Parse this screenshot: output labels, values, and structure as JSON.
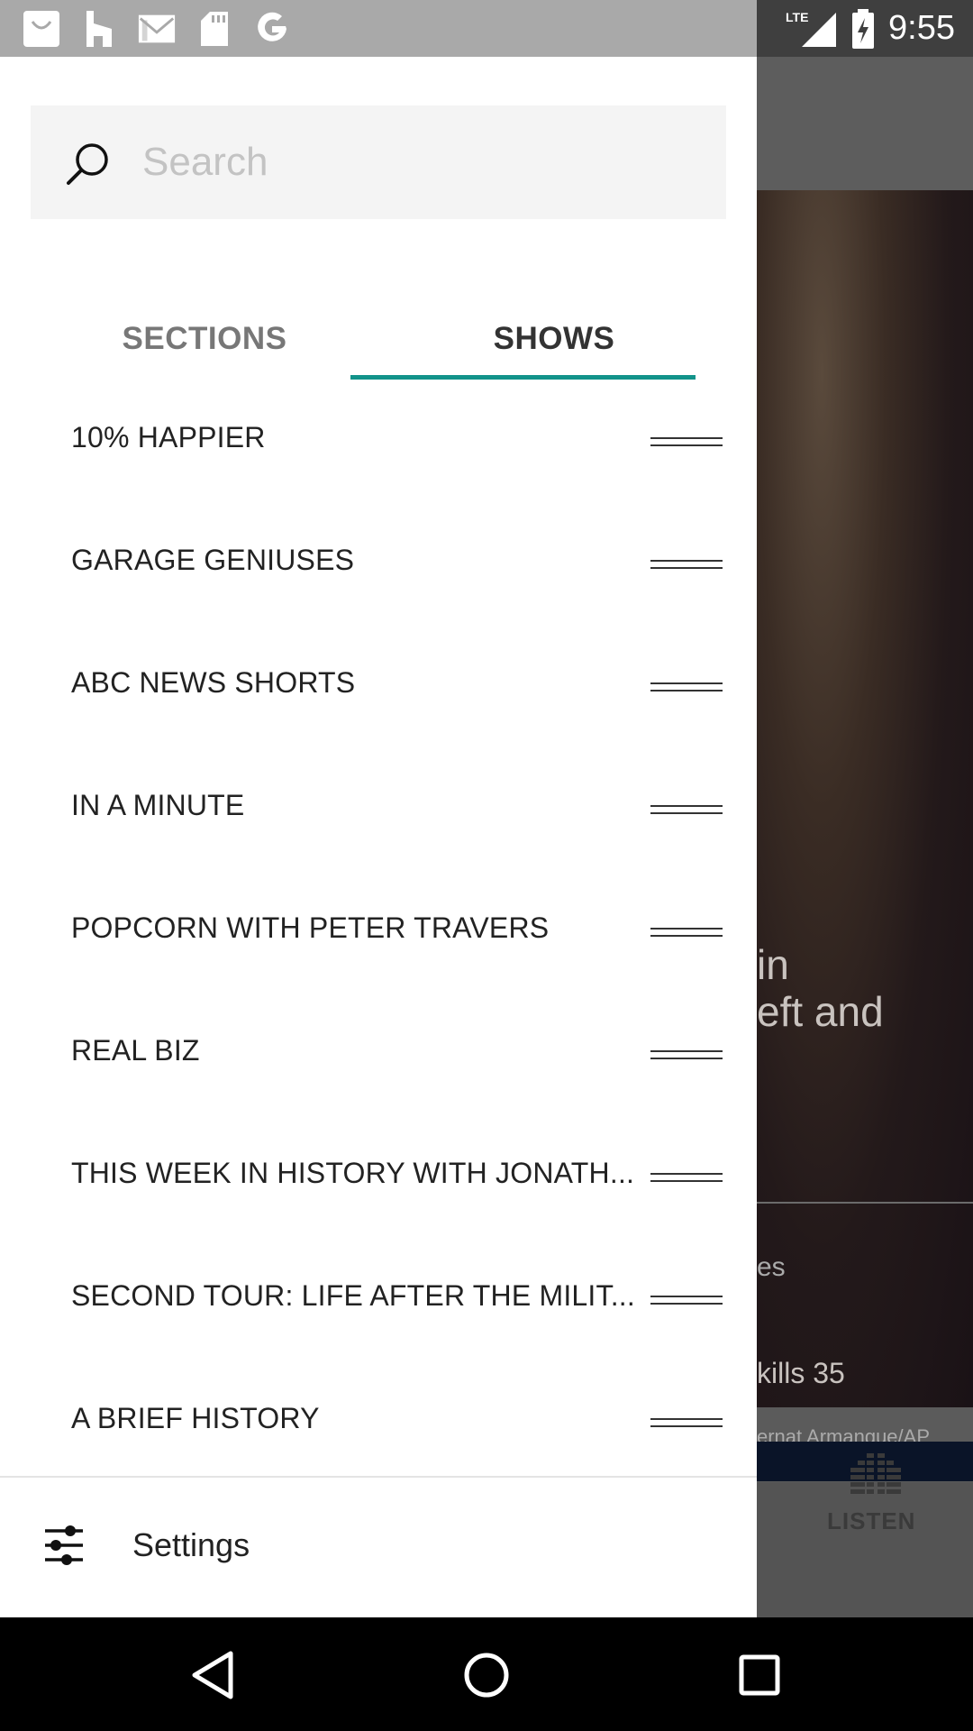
{
  "status_bar": {
    "time": "9:55",
    "network": "LTE",
    "notification_icons": [
      "shopping-bag-icon",
      "houzz-icon",
      "gmail-icon",
      "sd-card-icon",
      "google-icon"
    ]
  },
  "drawer": {
    "search": {
      "placeholder": "Search",
      "value": ""
    },
    "tabs": [
      {
        "label": "SECTIONS",
        "selected": false
      },
      {
        "label": "SHOWS",
        "selected": true
      }
    ],
    "accent_color": "#12938a",
    "shows": [
      {
        "label": "10% HAPPIER"
      },
      {
        "label": "GARAGE GENIUSES"
      },
      {
        "label": "ABC NEWS SHORTS"
      },
      {
        "label": "IN A MINUTE"
      },
      {
        "label": "POPCORN WITH PETER TRAVERS"
      },
      {
        "label": "REAL BIZ"
      },
      {
        "label": "THIS WEEK IN HISTORY WITH JONATH..."
      },
      {
        "label": "SECOND TOUR: LIFE AFTER THE MILIT..."
      },
      {
        "label": "A BRIEF HISTORY"
      }
    ],
    "settings": {
      "label": "Settings"
    }
  },
  "background": {
    "headline_line1": "in",
    "headline_line2": "eft and",
    "subtext": "es",
    "story_text": "kills 35",
    "photo_credit": "ernat Armangue/AP",
    "bottom_nav_label": "LISTEN"
  },
  "nav_bar": {
    "buttons": [
      "back-icon",
      "home-icon",
      "recents-icon"
    ]
  }
}
